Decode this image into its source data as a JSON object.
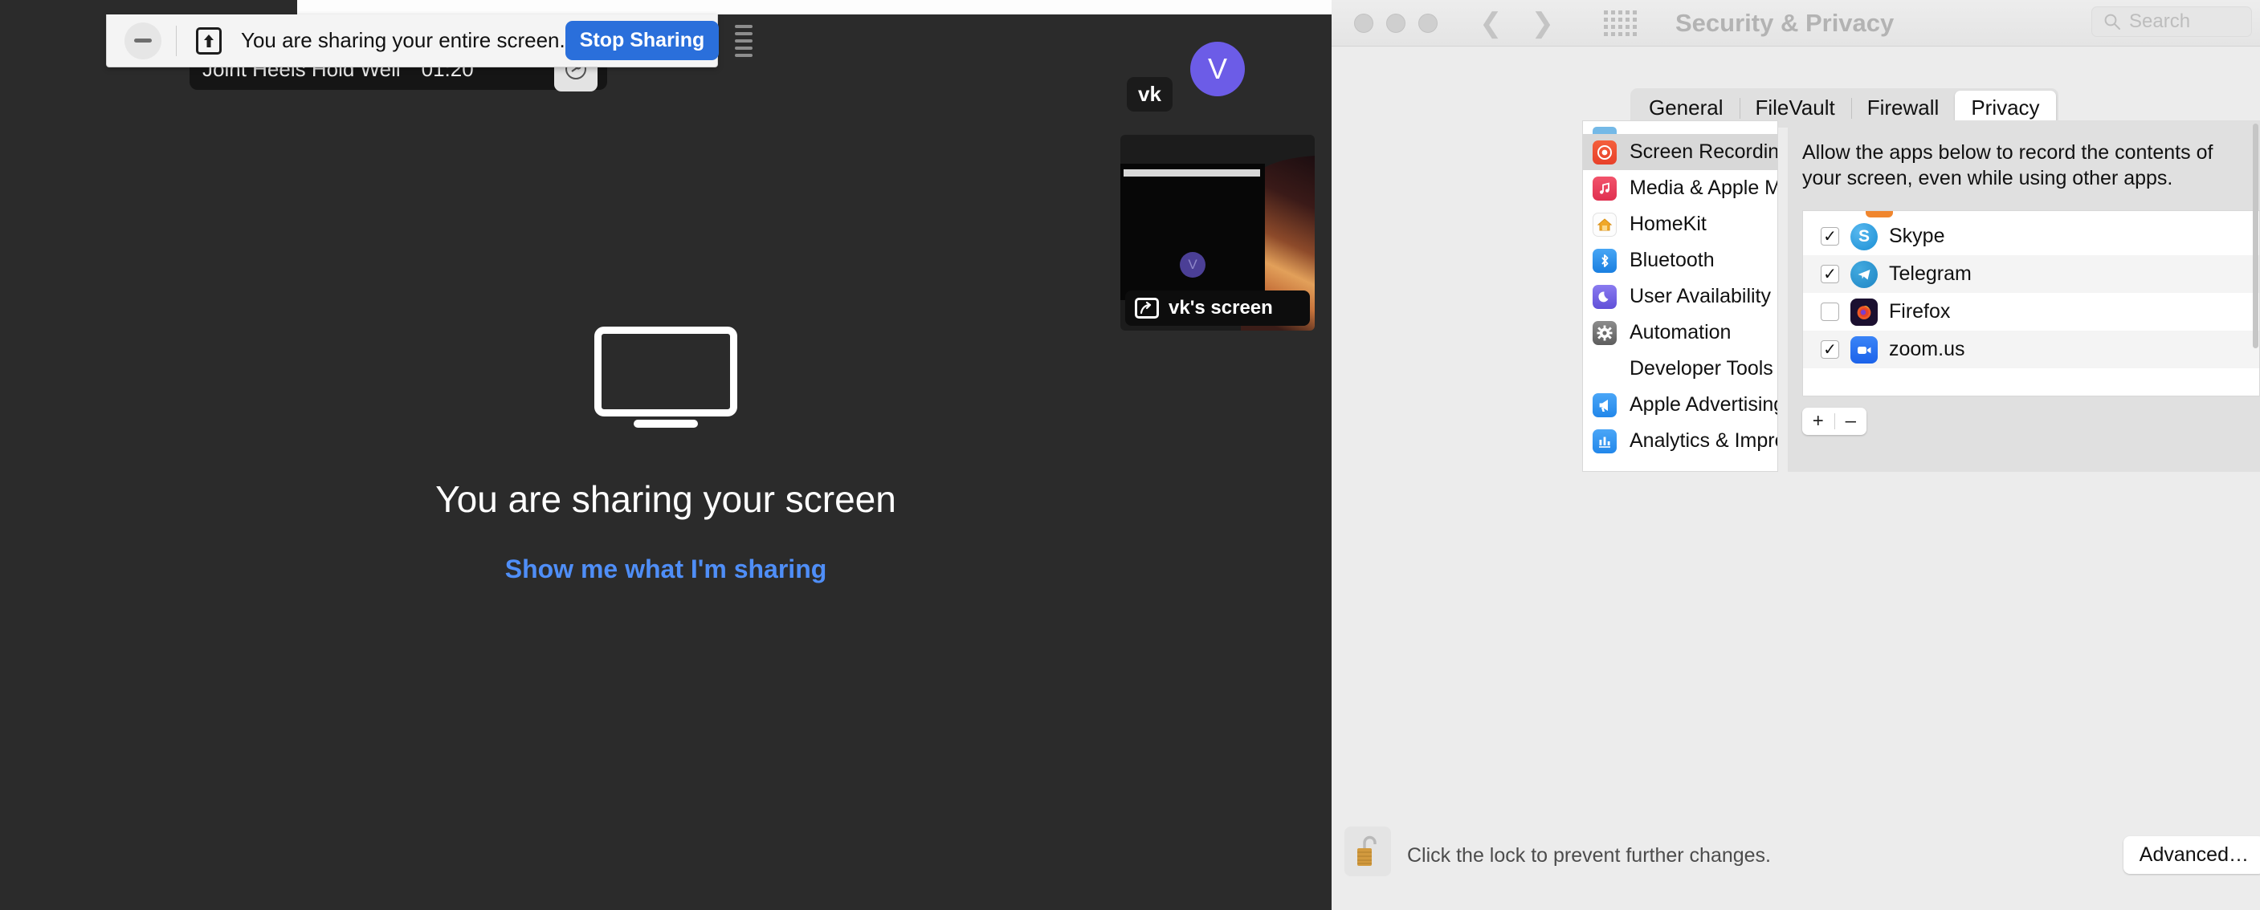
{
  "share_toolbar": {
    "collapse_icon": "minus-icon",
    "share_icon": "screen-share-up-icon",
    "message": "You are sharing your entire screen.",
    "stop_label": "Stop Sharing",
    "more_icon": "more-options-icon"
  },
  "meeting": {
    "title": "Joint Heels Hold Well",
    "timer": "01:20",
    "audio_icon": "audio-indicator-icon"
  },
  "share_status": {
    "monitor_icon": "monitor-icon",
    "heading": "You are sharing your screen",
    "link": "Show me what I'm sharing"
  },
  "participant": {
    "avatar_initial": "V",
    "avatar_color": "#6c5ce7",
    "name_chip": "vk",
    "thumb_label": "vk's screen",
    "thumb_share_icon": "share-arrow-icon",
    "thumb_avatar_initial": "V"
  },
  "sysprefs": {
    "window_title": "Security & Privacy",
    "traffic_lights": [
      "close-button",
      "minimize-button",
      "zoom-button"
    ],
    "nav_back_icon": "chevron-left-icon",
    "nav_forward_icon": "chevron-right-icon",
    "grid_icon": "show-all-grid-icon",
    "search": {
      "icon": "search-icon",
      "placeholder": "Search",
      "value": ""
    },
    "tabs": [
      {
        "label": "General",
        "active": false
      },
      {
        "label": "FileVault",
        "active": false
      },
      {
        "label": "Firewall",
        "active": false
      },
      {
        "label": "Privacy",
        "active": true
      }
    ],
    "sidebar": [
      {
        "label": "Screen Recording",
        "icon": "screen-recording-icon",
        "selected": true
      },
      {
        "label": "Media & Apple Music",
        "icon": "music-icon",
        "selected": false
      },
      {
        "label": "HomeKit",
        "icon": "homekit-icon",
        "selected": false
      },
      {
        "label": "Bluetooth",
        "icon": "bluetooth-icon",
        "selected": false
      },
      {
        "label": "User Availability",
        "icon": "moon-icon",
        "selected": false
      },
      {
        "label": "Automation",
        "icon": "gear-icon",
        "selected": false
      },
      {
        "label": "Developer Tools",
        "icon": "none",
        "selected": false
      },
      {
        "label": "Apple Advertising",
        "icon": "megaphone-icon",
        "selected": false
      },
      {
        "label": "Analytics & Improvements",
        "icon": "bar-chart-icon",
        "selected": false
      }
    ],
    "allow_text": "Allow the apps below to record the contents of your screen, even while using other apps.",
    "apps": [
      {
        "name": "Skype",
        "checked": true,
        "icon": "skype-icon"
      },
      {
        "name": "Telegram",
        "checked": true,
        "icon": "telegram-icon"
      },
      {
        "name": "Firefox",
        "checked": false,
        "icon": "firefox-icon"
      },
      {
        "name": "zoom.us",
        "checked": true,
        "icon": "zoom-icon"
      }
    ],
    "checkmark": "✓",
    "add_label": "+",
    "remove_label": "–",
    "lock": {
      "icon": "unlocked-padlock-icon",
      "text": "Click the lock to prevent further changes."
    },
    "advanced_label": "Advanced…"
  }
}
